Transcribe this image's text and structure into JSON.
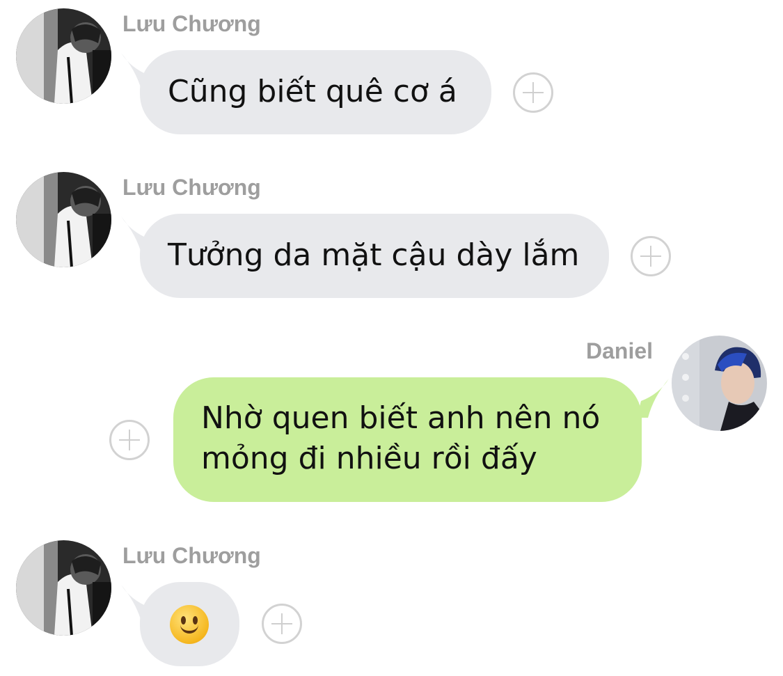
{
  "messages": [
    {
      "sender": "Lưu Chương",
      "direction": "incoming",
      "text": "Cũng biết quê cơ á"
    },
    {
      "sender": "Lưu Chương",
      "direction": "incoming",
      "text": "Tưởng da mặt cậu dày lắm"
    },
    {
      "sender": "Daniel",
      "direction": "outgoing",
      "text": "Nhờ quen biết anh nên nó",
      "text_line2": "mỏng đi nhiều rồi đấy"
    },
    {
      "sender": "Lưu Chương",
      "direction": "incoming",
      "emoji": "slightly-smiling-face"
    }
  ],
  "colors": {
    "incoming_bubble": "#e8e9ec",
    "outgoing_bubble": "#c9ee9a",
    "sender_name": "#9e9e9e",
    "add_reaction": "#d2d2d2"
  },
  "icons": {
    "add_reaction": "plus-circle-icon"
  }
}
